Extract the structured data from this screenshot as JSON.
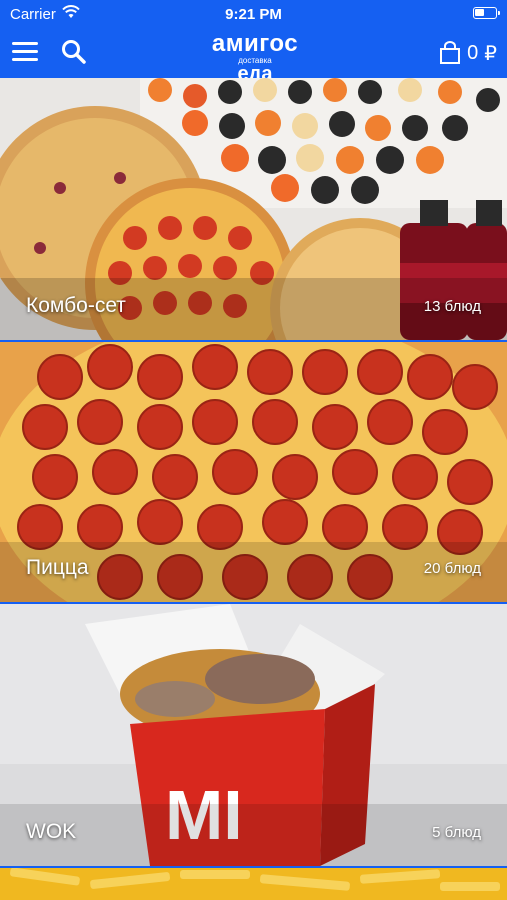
{
  "status_bar": {
    "carrier": "Carrier",
    "time": "9:21 PM"
  },
  "header": {
    "logo_line1": "амигос",
    "logo_line2": "доставка",
    "logo_line3": "еда",
    "cart_count": "0",
    "currency": "₽"
  },
  "categories": [
    {
      "title": "Комбо-сет",
      "count": "13 блюд"
    },
    {
      "title": "Пицца",
      "count": "20 блюд"
    },
    {
      "title": "WOK",
      "count": "5 блюд"
    }
  ],
  "colors": {
    "brand": "#1560f2"
  }
}
